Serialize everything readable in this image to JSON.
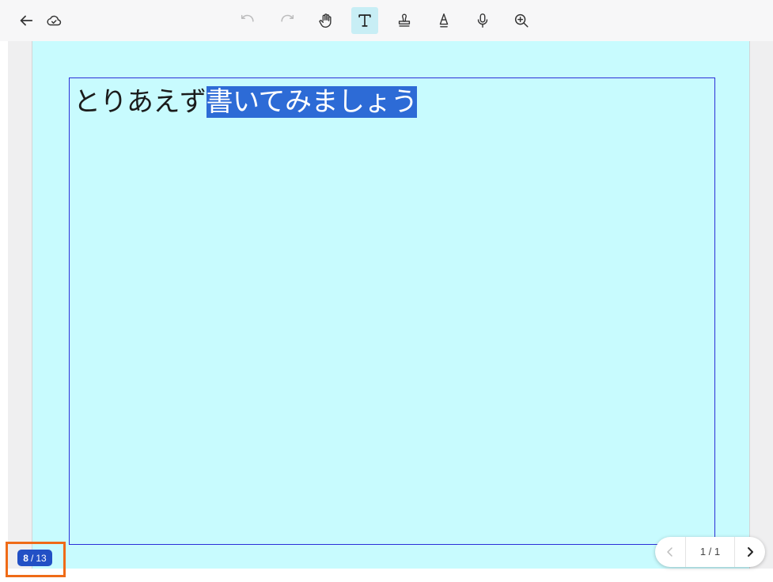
{
  "toolbar": {
    "icons": [
      "back-arrow-icon",
      "cloud-save-icon",
      "undo-icon",
      "redo-icon",
      "hand-icon",
      "text-tool-icon",
      "stamp-icon",
      "pen-tool-icon",
      "microphone-icon",
      "zoom-in-icon"
    ],
    "active_tool": "text",
    "accent_color": "#c8eef5"
  },
  "canvas": {
    "background_color": "#c8fbfe",
    "text_plain": "とりあえず",
    "text_selected": "書いてみましょう",
    "selection_color": "#2d6bd6",
    "textbox_border_color": "#2b2fd8"
  },
  "page_counter": {
    "current": "8",
    "separator": "/",
    "total": "13",
    "color": "#2250c5",
    "highlight_color": "#ef6b17"
  },
  "pager": {
    "label": "1 / 1"
  }
}
